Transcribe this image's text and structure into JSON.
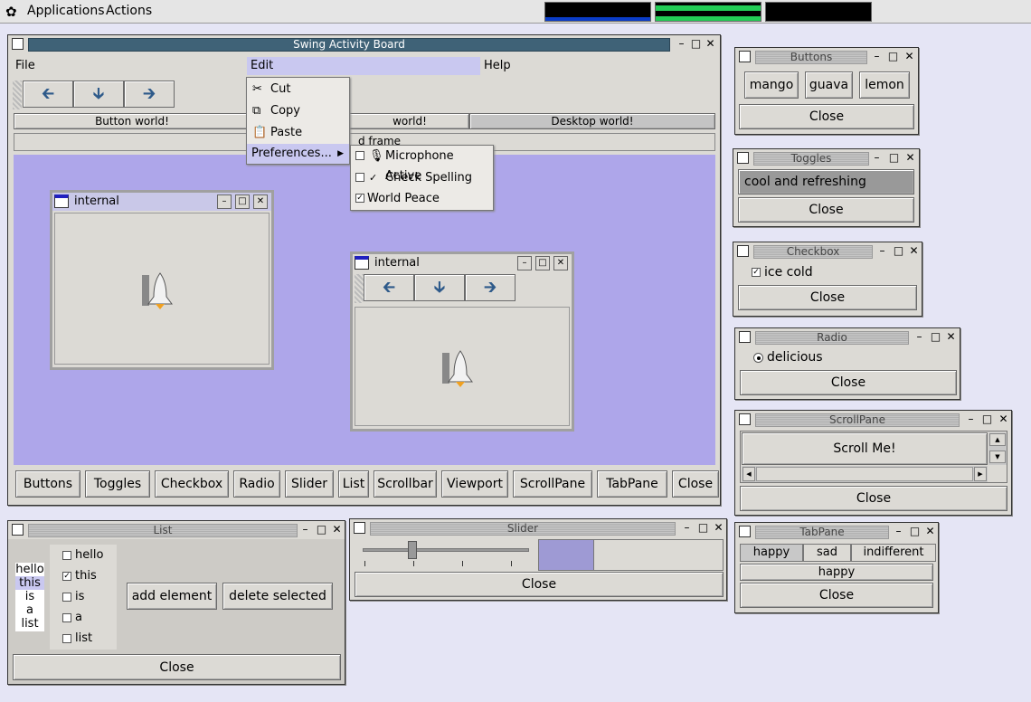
{
  "topbar": {
    "applications": "Applications",
    "actions": "Actions"
  },
  "main": {
    "title": "Swing Activity Board",
    "menu": {
      "file": "File",
      "edit": "Edit",
      "help": "Help"
    },
    "tabs": {
      "button_world": "Button world!",
      "world": "world!",
      "desktop_world": "Desktop world!"
    },
    "frame_hint": "d frame",
    "internal_title": "internal",
    "bottom_buttons": [
      "Buttons",
      "Toggles",
      "Checkbox",
      "Radio",
      "Slider",
      "List",
      "Scrollbar",
      "Viewport",
      "ScrollPane",
      "TabPane",
      "Close"
    ]
  },
  "edit_menu": {
    "cut": "Cut",
    "copy": "Copy",
    "paste": "Paste",
    "preferences": "Preferences..."
  },
  "prefs_menu": {
    "microphone": "Microphone Active",
    "spelling": "Check Spelling",
    "peace": "World Peace"
  },
  "buttons_win": {
    "title": "Buttons",
    "items": [
      "mango",
      "guava",
      "lemon"
    ],
    "close": "Close"
  },
  "toggles_win": {
    "title": "Toggles",
    "toggle": "cool and refreshing",
    "close": "Close"
  },
  "checkbox_win": {
    "title": "Checkbox",
    "item": "ice cold",
    "close": "Close"
  },
  "radio_win": {
    "title": "Radio",
    "item": "delicious",
    "close": "Close"
  },
  "scrollpane_win": {
    "title": "ScrollPane",
    "button": "Scroll Me!",
    "close": "Close"
  },
  "tabpane_win": {
    "title": "TabPane",
    "tabs": [
      "happy",
      "sad",
      "indifferent"
    ],
    "content": "happy",
    "close": "Close"
  },
  "list_win": {
    "title": "List",
    "list_items": [
      "hello",
      "this",
      "is",
      "a",
      "list"
    ],
    "checks": [
      "hello",
      "this",
      "is",
      "a",
      "list"
    ],
    "add": "add element",
    "delete": "delete selected",
    "close": "Close"
  },
  "slider_win": {
    "title": "Slider",
    "close": "Close",
    "value": 0.3
  }
}
